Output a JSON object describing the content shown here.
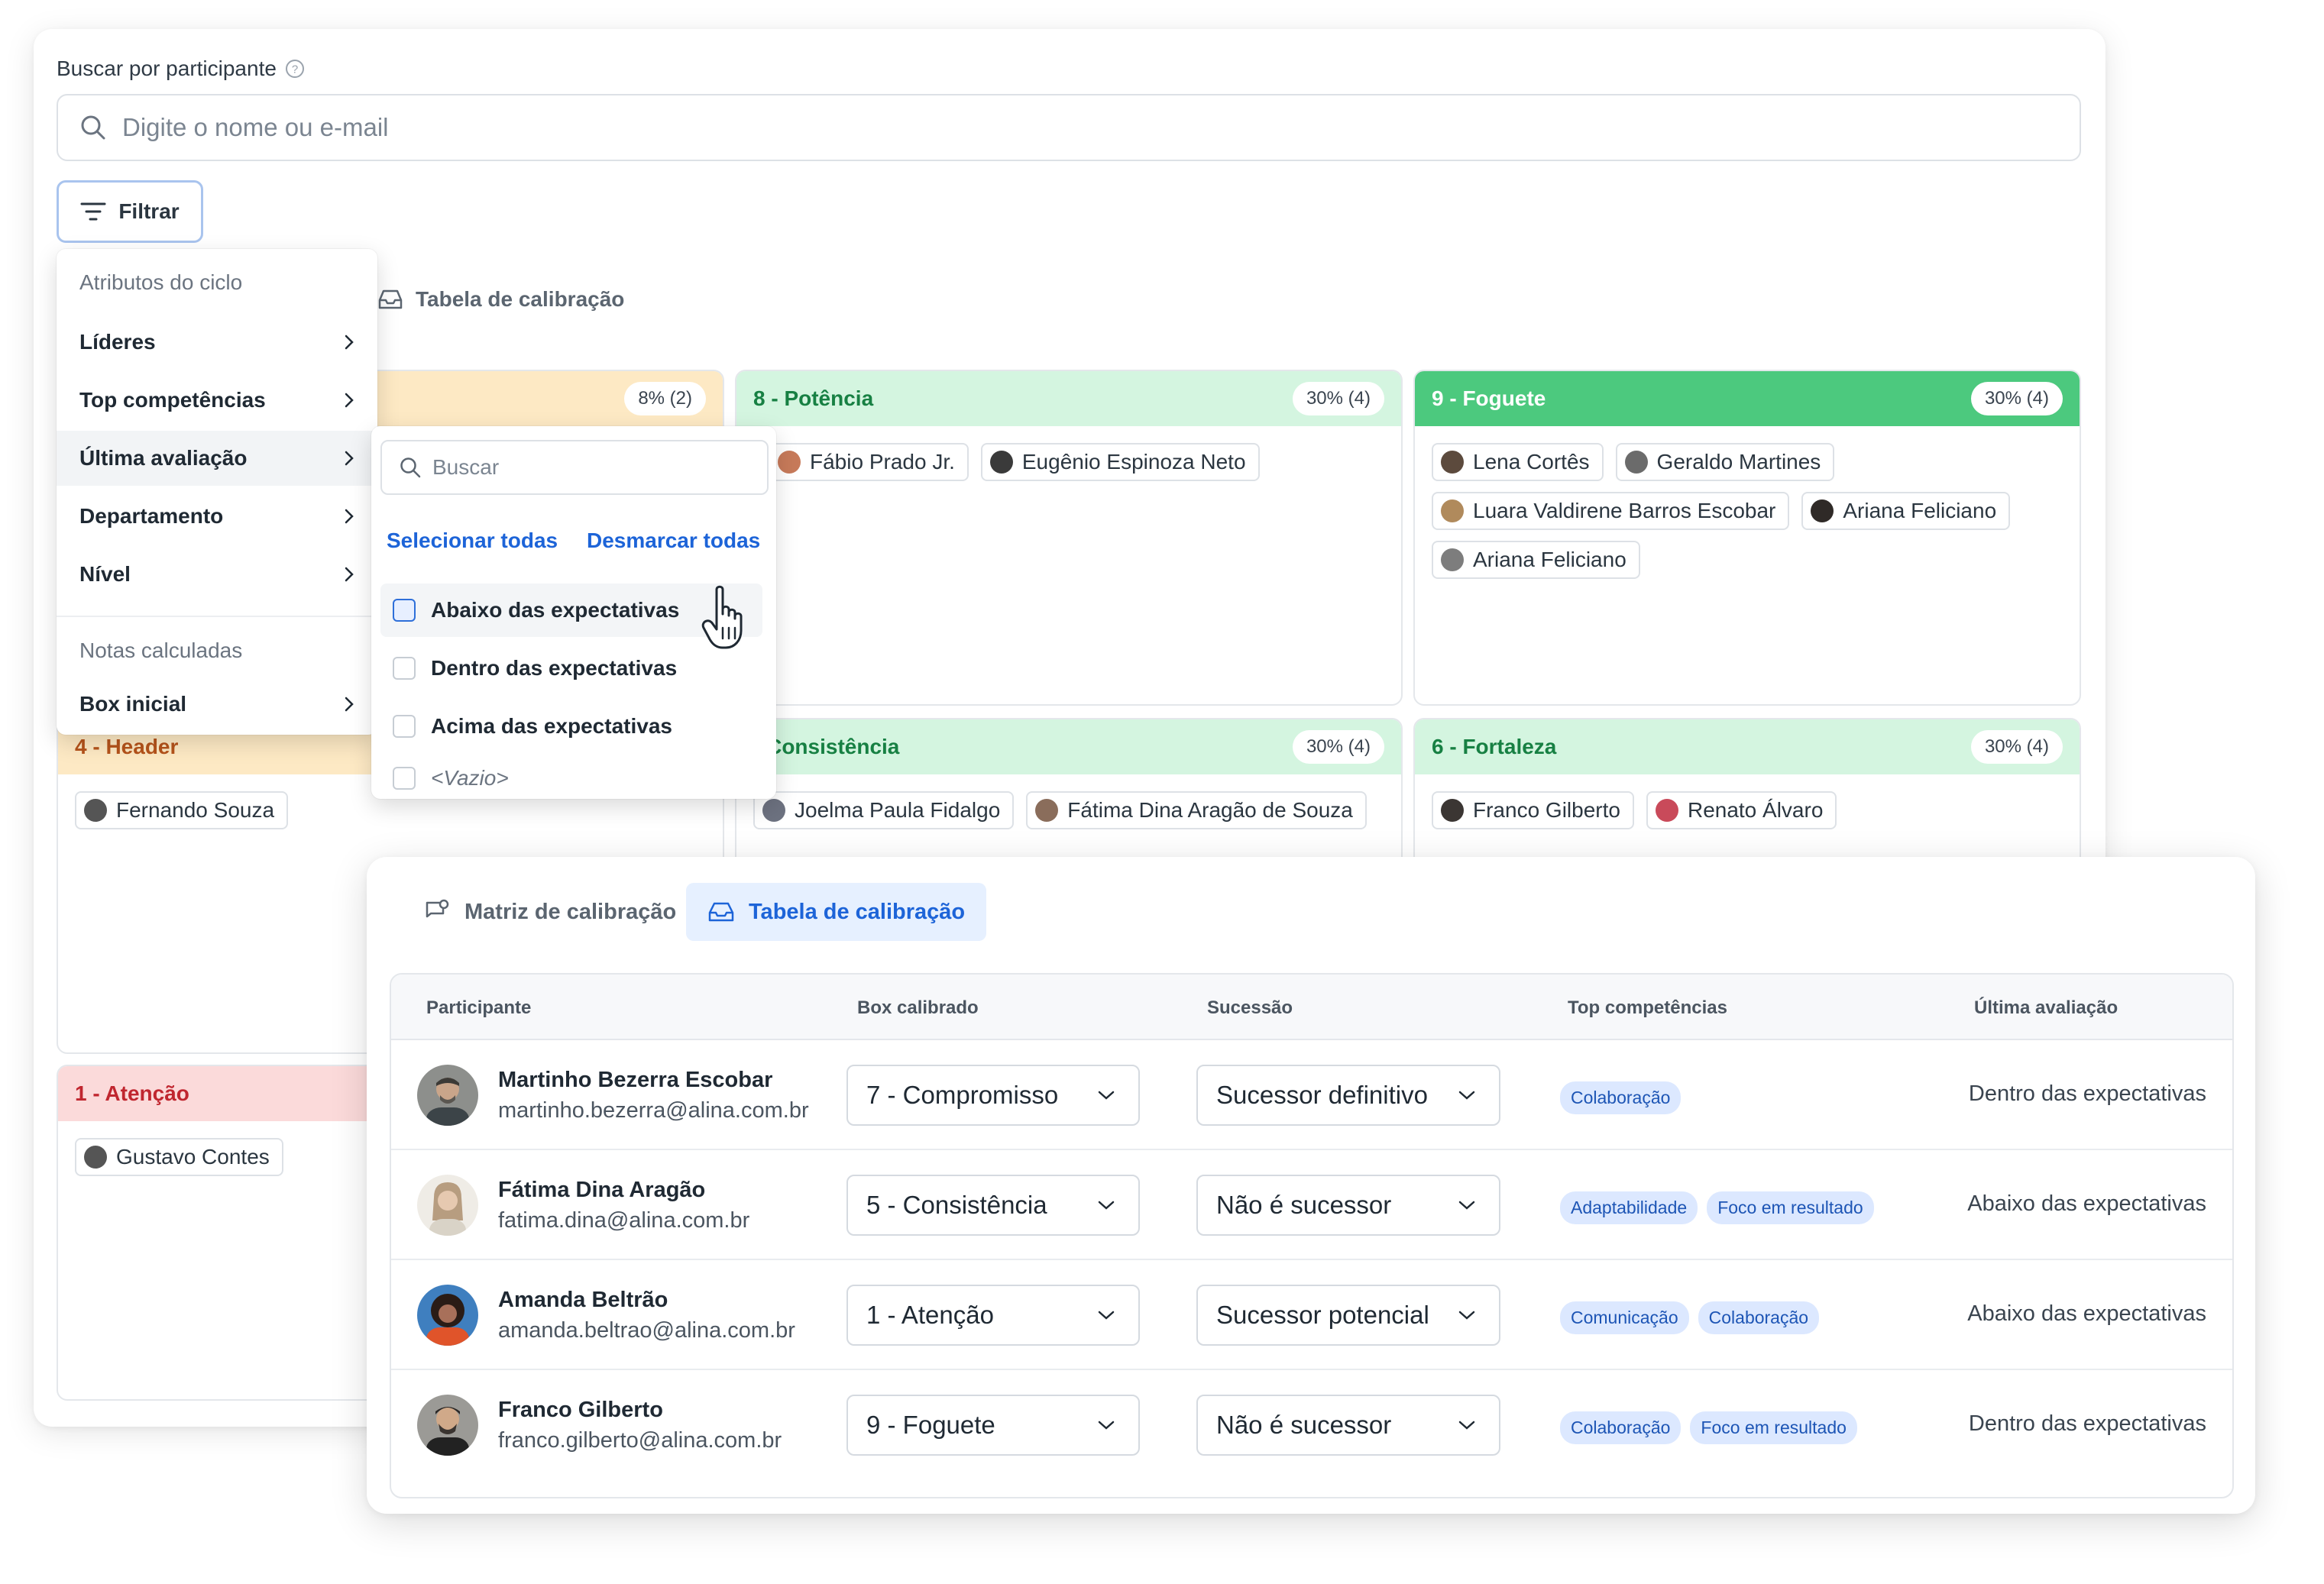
{
  "search": {
    "label": "Buscar por participante",
    "placeholder": "Digite o nome ou e-mail"
  },
  "filter_button": "Filtrar",
  "back_tab": "Tabela de calibração",
  "filter_menu": {
    "section1": "Atributos do ciclo",
    "items1": [
      "Líderes",
      "Top competências",
      "Última avaliação",
      "Departamento",
      "Nível"
    ],
    "section2": "Notas calculadas",
    "items2": [
      "Box inicial"
    ]
  },
  "submenu": {
    "search_placeholder": "Buscar",
    "select_all": "Selecionar todas",
    "deselect_all": "Desmarcar todas",
    "options": [
      "Abaixo das expectativas",
      "Dentro das expectativas",
      "Acima das expectativas",
      "<Vazio>"
    ]
  },
  "boxes": {
    "box_top_left_pct": "8% (2)",
    "potencia": {
      "title": "8 - Potência",
      "pct": "30% (4)",
      "people": [
        "Fábio Prado Jr.",
        "Eugênio Espinoza Neto"
      ]
    },
    "foguete": {
      "title": "9 - Foguete",
      "pct": "30% (4)",
      "people": [
        "Lena Cortês",
        "Geraldo Martines",
        "Luara Valdirene Barros Escobar",
        "Ariana Feliciano",
        "Ariana Feliciano"
      ]
    },
    "header": {
      "title": "4 - Header",
      "people": [
        "Fernando Souza"
      ]
    },
    "consistencia": {
      "title": "- Consistência",
      "pct": "30% (4)",
      "people": [
        "Joelma Paula Fidalgo",
        "Fátima Dina Aragão de Souza"
      ]
    },
    "fortaleza": {
      "title": "6 - Fortaleza",
      "pct": "30% (4)",
      "people": [
        "Franco Gilberto",
        "Renato Álvaro"
      ]
    },
    "atencao": {
      "title": "1 - Atenção",
      "people": [
        "Gustavo Contes"
      ]
    }
  },
  "front": {
    "tabs": [
      "Matriz de calibração",
      "Tabela de calibração"
    ],
    "columns": [
      "Participante",
      "Box calibrado",
      "Sucessão",
      "Top competências",
      "Última avaliação"
    ],
    "rows": [
      {
        "name": "Martinho Bezerra Escobar",
        "email": "martinho.bezerra@alina.com.br",
        "box": "7 - Compromisso",
        "succession": "Sucessor definitivo",
        "tags": [
          "Colaboração"
        ],
        "last": "Dentro das expectativas"
      },
      {
        "name": "Fátima Dina Aragão",
        "email": "fatima.dina@alina.com.br",
        "box": "5 - Consistência",
        "succession": "Não é sucessor",
        "tags": [
          "Adaptabilidade",
          "Foco em resultado"
        ],
        "last": "Abaixo das expectativas"
      },
      {
        "name": "Amanda Beltrão",
        "email": "amanda.beltrao@alina.com.br",
        "box": "1 - Atenção",
        "succession": "Sucessor potencial",
        "tags": [
          "Comunicação",
          "Colaboração"
        ],
        "last": "Abaixo das expectativas"
      },
      {
        "name": "Franco Gilberto",
        "email": "franco.gilberto@alina.com.br",
        "box": "9 - Foguete",
        "succession": "Não é sucessor",
        "tags": [
          "Colaboração",
          "Foco em resultado"
        ],
        "last": "Dentro das expectativas"
      }
    ]
  },
  "colors": {
    "accent": "#1d64d8",
    "potencia_header": "#d4f5e0",
    "foguete_header": "#4cc97e",
    "header_box": "#fde9c4",
    "atencao_box": "#fbdada",
    "tag_bg": "#dce8ff"
  }
}
